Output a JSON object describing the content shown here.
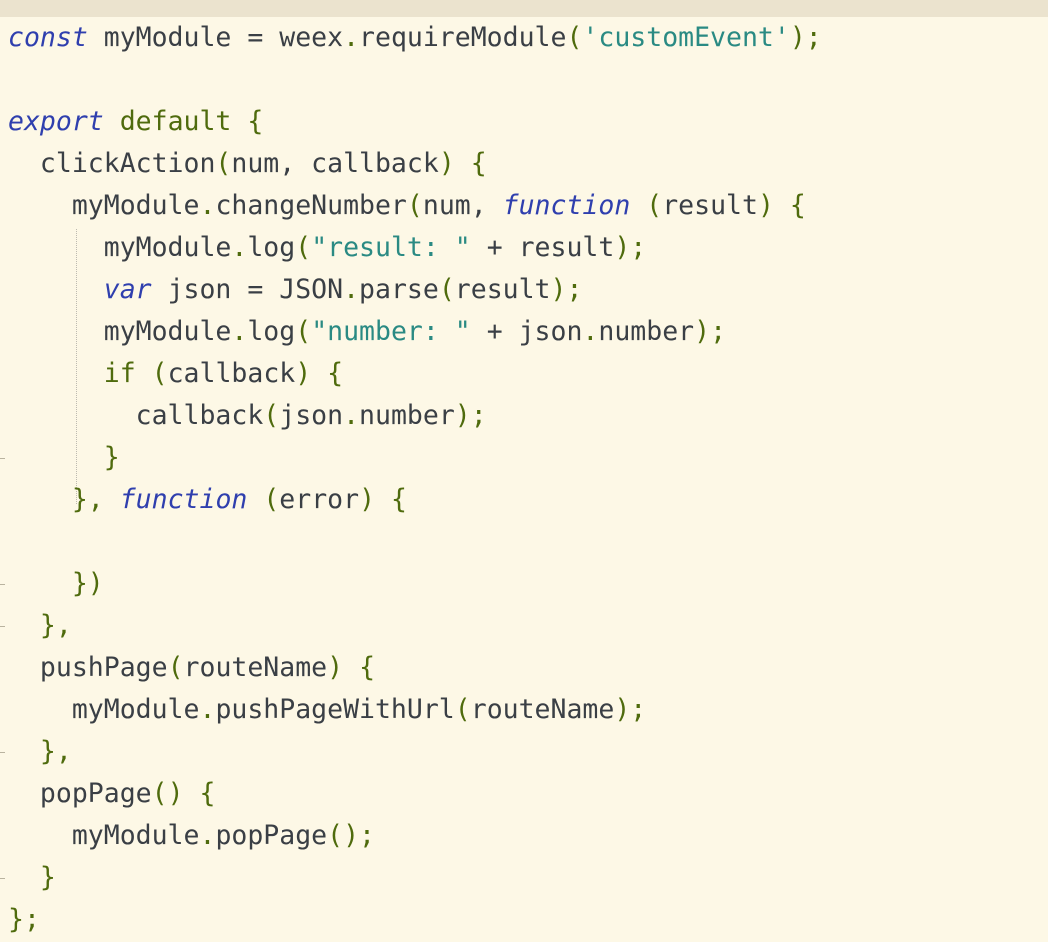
{
  "editor": {
    "language": "javascript",
    "colors": {
      "background": "#fdf8e6",
      "top_band": "#ebe3ce",
      "keyword": "#2f3fae",
      "string": "#2a8a83",
      "punctuation": "#4f6b0d",
      "identifier": "#3a3f45"
    },
    "lines": [
      {
        "indent": "",
        "tokens": [
          [
            "kw",
            "const"
          ],
          [
            "id",
            " myModule = weex"
          ],
          [
            "punc",
            "."
          ],
          [
            "id",
            "requireModule"
          ],
          [
            "punc",
            "("
          ],
          [
            "str",
            "'customEvent'"
          ],
          [
            "punc",
            ");"
          ]
        ]
      },
      {
        "indent": "",
        "tokens": []
      },
      {
        "indent": "",
        "tokens": [
          [
            "kw",
            "export"
          ],
          [
            "id",
            " "
          ],
          [
            "kw2",
            "default"
          ],
          [
            "id",
            " "
          ],
          [
            "punc",
            "{"
          ]
        ]
      },
      {
        "indent": "  ",
        "tokens": [
          [
            "id",
            "clickAction"
          ],
          [
            "punc",
            "("
          ],
          [
            "id",
            "num, callback"
          ],
          [
            "punc",
            ")"
          ],
          [
            "id",
            " "
          ],
          [
            "punc",
            "{"
          ]
        ]
      },
      {
        "indent": "    ",
        "tokens": [
          [
            "id",
            "myModule"
          ],
          [
            "punc",
            "."
          ],
          [
            "id",
            "changeNumber"
          ],
          [
            "punc",
            "("
          ],
          [
            "id",
            "num, "
          ],
          [
            "kw",
            "function"
          ],
          [
            "id",
            " "
          ],
          [
            "punc",
            "("
          ],
          [
            "id",
            "result"
          ],
          [
            "punc",
            ")"
          ],
          [
            "id",
            " "
          ],
          [
            "punc",
            "{"
          ]
        ]
      },
      {
        "indent": "      ",
        "tokens": [
          [
            "id",
            "myModule"
          ],
          [
            "punc",
            "."
          ],
          [
            "id",
            "log"
          ],
          [
            "punc",
            "("
          ],
          [
            "str",
            "\"result: \""
          ],
          [
            "id",
            " + result"
          ],
          [
            "punc",
            ");"
          ]
        ]
      },
      {
        "indent": "      ",
        "tokens": [
          [
            "kw",
            "var"
          ],
          [
            "id",
            " json = JSON"
          ],
          [
            "punc",
            "."
          ],
          [
            "id",
            "parse"
          ],
          [
            "punc",
            "("
          ],
          [
            "id",
            "result"
          ],
          [
            "punc",
            ");"
          ]
        ]
      },
      {
        "indent": "      ",
        "tokens": [
          [
            "id",
            "myModule"
          ],
          [
            "punc",
            "."
          ],
          [
            "id",
            "log"
          ],
          [
            "punc",
            "("
          ],
          [
            "str",
            "\"number: \""
          ],
          [
            "id",
            " + json"
          ],
          [
            "punc",
            "."
          ],
          [
            "id",
            "number"
          ],
          [
            "punc",
            ");"
          ]
        ]
      },
      {
        "indent": "      ",
        "tokens": [
          [
            "kw2",
            "if"
          ],
          [
            "id",
            " "
          ],
          [
            "punc",
            "("
          ],
          [
            "id",
            "callback"
          ],
          [
            "punc",
            ")"
          ],
          [
            "id",
            " "
          ],
          [
            "punc",
            "{"
          ]
        ]
      },
      {
        "indent": "        ",
        "tokens": [
          [
            "id",
            "callback"
          ],
          [
            "punc",
            "("
          ],
          [
            "id",
            "json"
          ],
          [
            "punc",
            "."
          ],
          [
            "id",
            "number"
          ],
          [
            "punc",
            ");"
          ]
        ]
      },
      {
        "indent": "      ",
        "tokens": [
          [
            "punc",
            "}"
          ]
        ]
      },
      {
        "indent": "    ",
        "tokens": [
          [
            "punc",
            "},"
          ],
          [
            "id",
            " "
          ],
          [
            "kw",
            "function"
          ],
          [
            "id",
            " "
          ],
          [
            "punc",
            "("
          ],
          [
            "id",
            "error"
          ],
          [
            "punc",
            ")"
          ],
          [
            "id",
            " "
          ],
          [
            "punc",
            "{"
          ]
        ]
      },
      {
        "indent": "",
        "tokens": []
      },
      {
        "indent": "    ",
        "tokens": [
          [
            "punc",
            "})"
          ]
        ]
      },
      {
        "indent": "  ",
        "tokens": [
          [
            "punc",
            "},"
          ]
        ]
      },
      {
        "indent": "  ",
        "tokens": [
          [
            "id",
            "pushPage"
          ],
          [
            "punc",
            "("
          ],
          [
            "id",
            "routeName"
          ],
          [
            "punc",
            ")"
          ],
          [
            "id",
            " "
          ],
          [
            "punc",
            "{"
          ]
        ]
      },
      {
        "indent": "    ",
        "tokens": [
          [
            "id",
            "myModule"
          ],
          [
            "punc",
            "."
          ],
          [
            "id",
            "pushPageWithUrl"
          ],
          [
            "punc",
            "("
          ],
          [
            "id",
            "routeName"
          ],
          [
            "punc",
            ");"
          ]
        ]
      },
      {
        "indent": "  ",
        "tokens": [
          [
            "punc",
            "},"
          ]
        ]
      },
      {
        "indent": "  ",
        "tokens": [
          [
            "id",
            "popPage"
          ],
          [
            "punc",
            "()"
          ],
          [
            "id",
            " "
          ],
          [
            "punc",
            "{"
          ]
        ]
      },
      {
        "indent": "    ",
        "tokens": [
          [
            "id",
            "myModule"
          ],
          [
            "punc",
            "."
          ],
          [
            "id",
            "popPage"
          ],
          [
            "punc",
            "();"
          ]
        ]
      },
      {
        "indent": "  ",
        "tokens": [
          [
            "punc",
            "}"
          ]
        ]
      },
      {
        "indent": "",
        "tokens": [
          [
            "punc",
            "};"
          ]
        ]
      }
    ]
  }
}
